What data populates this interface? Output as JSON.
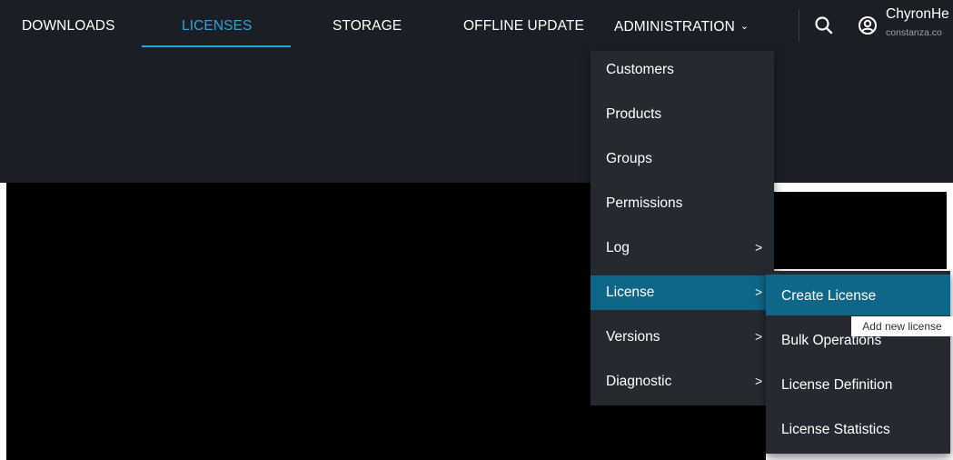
{
  "nav": {
    "items": [
      "DOWNLOADS",
      "LICENSES",
      "STORAGE",
      "OFFLINE UPDATE",
      "ADMINISTRATION"
    ],
    "active_color": "#2aa4dc"
  },
  "user": {
    "name": "ChyronHe",
    "email": "constanza.co"
  },
  "menu": {
    "items": [
      {
        "label": "Customers"
      },
      {
        "label": "Products"
      },
      {
        "label": "Groups"
      },
      {
        "label": "Permissions"
      },
      {
        "label": "Log",
        "arrow": ">"
      },
      {
        "label": "License",
        "arrow": ">"
      },
      {
        "label": "Versions",
        "arrow": ">"
      },
      {
        "label": "Diagnostic",
        "arrow": ">"
      }
    ]
  },
  "submenu": {
    "items": [
      {
        "label": "Create License"
      },
      {
        "label": "Bulk Operations"
      },
      {
        "label": "License Definition"
      },
      {
        "label": "License Statistics"
      }
    ]
  },
  "tooltip": "Add new license",
  "icons": {
    "chevron": "chevron-down-icon",
    "search": "search-icon",
    "user": "user-circle-icon"
  },
  "colors": {
    "bar": "#1b1f25",
    "menu": "#252a31",
    "highlight": "#0e6688"
  }
}
